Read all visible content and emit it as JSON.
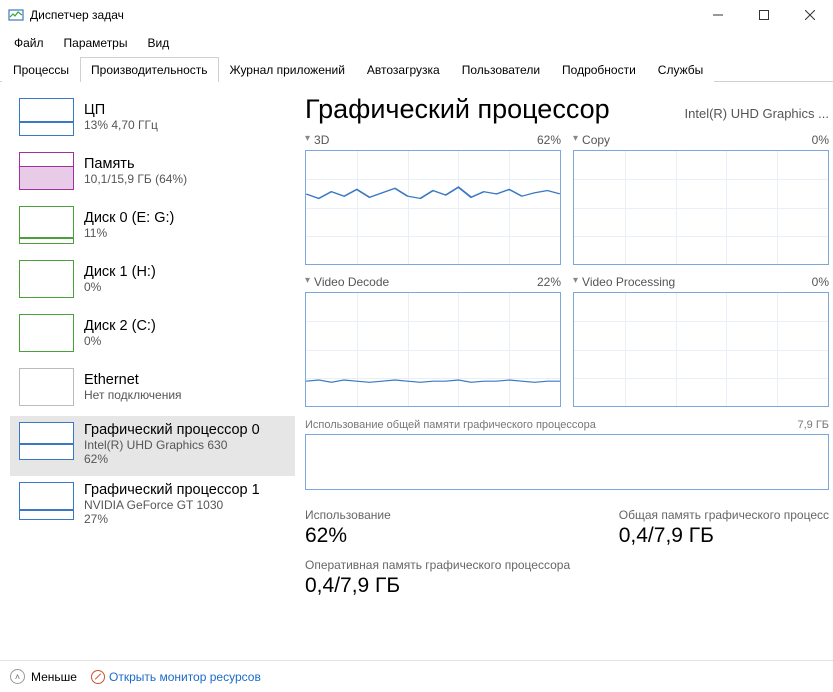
{
  "window": {
    "title": "Диспетчер задач"
  },
  "menu": {
    "file": "Файл",
    "options": "Параметры",
    "view": "Вид"
  },
  "tabs": {
    "processes": "Процессы",
    "performance": "Производительность",
    "app_history": "Журнал приложений",
    "startup": "Автозагрузка",
    "users": "Пользователи",
    "details": "Подробности",
    "services": "Службы"
  },
  "sidebar": {
    "cpu": {
      "title": "ЦП",
      "sub": "13% 4,70 ГГц"
    },
    "mem": {
      "title": "Память",
      "sub": "10,1/15,9 ГБ (64%)"
    },
    "disk0": {
      "title": "Диск 0 (E: G:)",
      "sub": "11%"
    },
    "disk1": {
      "title": "Диск 1 (H:)",
      "sub": "0%"
    },
    "disk2": {
      "title": "Диск 2 (C:)",
      "sub": "0%"
    },
    "eth": {
      "title": "Ethernet",
      "sub": "Нет подключения"
    },
    "gpu0": {
      "title": "Графический процессор 0",
      "sub1": "Intel(R) UHD Graphics 630",
      "sub2": "62%"
    },
    "gpu1": {
      "title": "Графический процессор 1",
      "sub1": "NVIDIA GeForce GT 1030",
      "sub2": "27%"
    }
  },
  "main": {
    "title": "Графический процессор",
    "subtitle": "Intel(R) UHD Graphics ...",
    "charts": {
      "c3d": {
        "label": "3D",
        "pct": "62%"
      },
      "copy": {
        "label": "Copy",
        "pct": "0%"
      },
      "vdec": {
        "label": "Video Decode",
        "pct": "22%"
      },
      "vproc": {
        "label": "Video Processing",
        "pct": "0%"
      }
    },
    "shared_label": "Использование общей памяти графического процессора",
    "shared_max": "7,9 ГБ",
    "stats": {
      "usage_label": "Использование",
      "usage_value": "62%",
      "shared_label": "Общая память графического процесс",
      "shared_value": "0,4/7,9 ГБ",
      "dedicated_label": "Оперативная память графического процессора",
      "dedicated_value": "0,4/7,9 ГБ"
    }
  },
  "footer": {
    "less": "Меньше",
    "resmon": "Открыть монитор ресурсов"
  },
  "chart_data": [
    {
      "name": "3D",
      "type": "line",
      "ylim": [
        0,
        100
      ],
      "values": [
        62,
        58,
        64,
        60,
        66,
        59,
        63,
        67,
        60,
        58,
        65,
        61,
        68,
        59,
        64,
        62,
        66,
        60,
        63,
        65
      ]
    },
    {
      "name": "Copy",
      "type": "line",
      "ylim": [
        0,
        100
      ],
      "values": [
        0,
        0,
        0,
        0,
        0,
        0,
        0,
        0,
        0,
        0,
        0,
        0,
        0,
        0,
        0,
        0,
        0,
        0,
        0,
        0
      ]
    },
    {
      "name": "Video Decode",
      "type": "line",
      "ylim": [
        0,
        100
      ],
      "values": [
        20,
        22,
        21,
        23,
        22,
        21,
        22,
        23,
        22,
        21,
        22,
        22,
        23,
        21,
        22,
        22,
        23,
        22,
        21,
        22
      ]
    },
    {
      "name": "Video Processing",
      "type": "line",
      "ylim": [
        0,
        100
      ],
      "values": [
        0,
        0,
        0,
        0,
        0,
        0,
        0,
        0,
        0,
        0,
        0,
        0,
        0,
        0,
        0,
        0,
        0,
        0,
        0,
        0
      ]
    },
    {
      "name": "Shared GPU Memory",
      "type": "line",
      "ylim": [
        0,
        7.9
      ],
      "unit": "GB",
      "values": [
        0.4,
        0.4,
        0.4,
        0.4,
        0.4,
        0.4,
        0.4,
        0.4,
        0.4,
        0.4,
        0.4,
        0.4,
        0.4,
        0.4,
        0.4,
        0.4,
        0.4,
        0.4,
        0.4,
        0.4
      ]
    }
  ]
}
